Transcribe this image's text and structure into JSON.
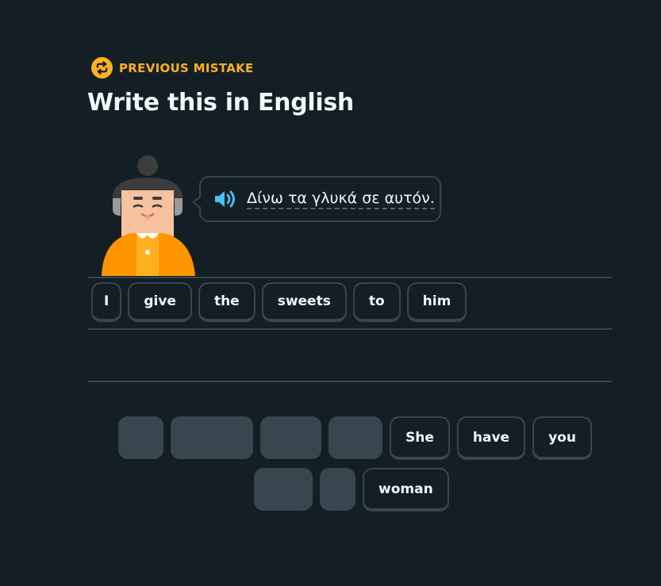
{
  "header": {
    "previous_mistake_label": "PREVIOUS MISTAKE",
    "title": "Write this in English"
  },
  "prompt": {
    "text": "Δίνω τα γλυκά σε αυτόν.",
    "speaker_icon": "speaker-icon"
  },
  "answer_tiles": [
    "I",
    "give",
    "the",
    "sweets",
    "to",
    "him"
  ],
  "word_bank": {
    "row1_words": [
      "She",
      "have",
      "you"
    ],
    "row2_words": [
      "woman"
    ],
    "used_slot_count": 6
  },
  "colors": {
    "background": "#131f24",
    "accent": "#ffb020",
    "border": "#37464f",
    "speaker_blue": "#49c0f8",
    "text": "#f1f7fb"
  }
}
